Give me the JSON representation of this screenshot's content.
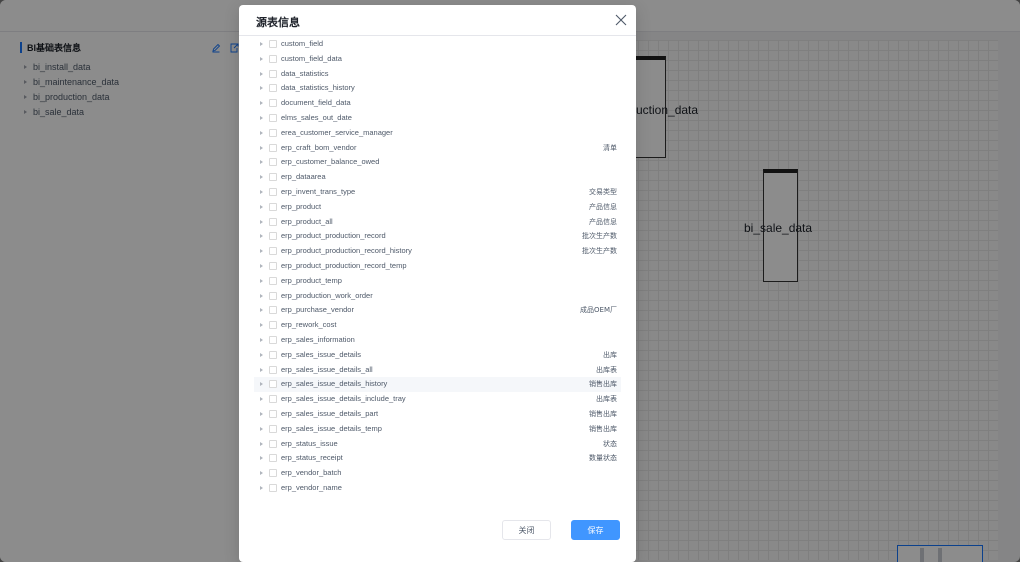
{
  "background": {
    "panel_title": "BI基础表信息",
    "tree_items": [
      "bi_install_data",
      "bi_maintenance_data",
      "bi_production_data",
      "bi_sale_data"
    ],
    "canvas_nodes": [
      "uction_data",
      "bi_sale_data"
    ]
  },
  "modal": {
    "title": "源表信息",
    "rows": [
      {
        "name": "custom_field",
        "comment": ""
      },
      {
        "name": "custom_field_data",
        "comment": ""
      },
      {
        "name": "data_statistics",
        "comment": ""
      },
      {
        "name": "data_statistics_history",
        "comment": ""
      },
      {
        "name": "document_field_data",
        "comment": ""
      },
      {
        "name": "elms_sales_out_date",
        "comment": ""
      },
      {
        "name": "erea_customer_service_manager",
        "comment": ""
      },
      {
        "name": "erp_craft_bom_vendor",
        "comment": "清单"
      },
      {
        "name": "erp_customer_balance_owed",
        "comment": ""
      },
      {
        "name": "erp_dataarea",
        "comment": ""
      },
      {
        "name": "erp_invent_trans_type",
        "comment": "交易类型"
      },
      {
        "name": "erp_product",
        "comment": "产品信息"
      },
      {
        "name": "erp_product_all",
        "comment": "产品信息"
      },
      {
        "name": "erp_product_production_record",
        "comment": "批次生产数"
      },
      {
        "name": "erp_product_production_record_history",
        "comment": "批次生产数"
      },
      {
        "name": "erp_product_production_record_temp",
        "comment": ""
      },
      {
        "name": "erp_product_temp",
        "comment": ""
      },
      {
        "name": "erp_production_work_order",
        "comment": ""
      },
      {
        "name": "erp_purchase_vendor",
        "comment": "成品OEM厂"
      },
      {
        "name": "erp_rework_cost",
        "comment": ""
      },
      {
        "name": "erp_sales_information",
        "comment": ""
      },
      {
        "name": "erp_sales_issue_details",
        "comment": "出库"
      },
      {
        "name": "erp_sales_issue_details_all",
        "comment": "出库表"
      },
      {
        "name": "erp_sales_issue_details_history",
        "comment": "销售出库"
      },
      {
        "name": "erp_sales_issue_details_include_tray",
        "comment": "出库表"
      },
      {
        "name": "erp_sales_issue_details_part",
        "comment": "销售出库"
      },
      {
        "name": "erp_sales_issue_details_temp",
        "comment": "销售出库"
      },
      {
        "name": "erp_status_issue",
        "comment": "状态"
      },
      {
        "name": "erp_status_receipt",
        "comment": "数量状态"
      },
      {
        "name": "erp_vendor_batch",
        "comment": ""
      },
      {
        "name": "erp_vendor_name",
        "comment": ""
      }
    ],
    "highlighted_index": 23,
    "cancel_label": "关闭",
    "save_label": "保存"
  },
  "colors": {
    "primary": "#4096ff",
    "accent_bar": "#1677ff",
    "overlay": "rgba(0,0,0,0.45)"
  }
}
